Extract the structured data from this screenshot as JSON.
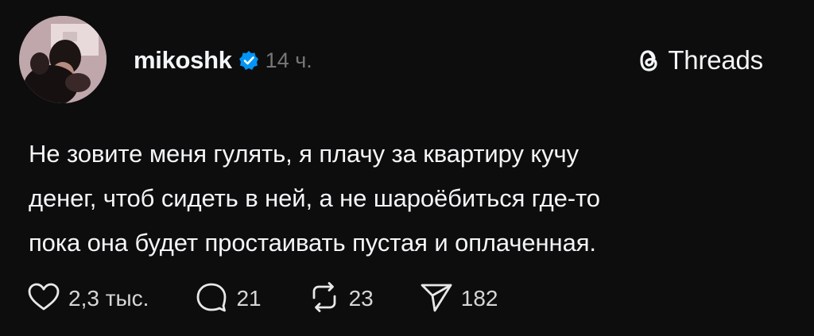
{
  "post": {
    "author": {
      "username": "mikoshk",
      "verified": true,
      "timestamp": "14 ч."
    },
    "brand": {
      "name": "Threads",
      "icon": "threads-logo-icon"
    },
    "text_lines": [
      "Не зовите меня гулять, я плачу за квартиру кучу",
      "денег, чтоб сидеть в ней, а не шароёбиться где-то",
      "пока она будет простаивать пустая и оплаченная."
    ],
    "actions": [
      {
        "icon": "heart-icon",
        "count": "2,3 тыс."
      },
      {
        "icon": "comment-icon",
        "count": "21"
      },
      {
        "icon": "repost-icon",
        "count": "23"
      },
      {
        "icon": "share-icon",
        "count": "182"
      }
    ]
  },
  "colors": {
    "background": "#0d0d0d",
    "text": "#f3f5f7",
    "muted": "#777777",
    "verified_badge": "#0095f6"
  }
}
